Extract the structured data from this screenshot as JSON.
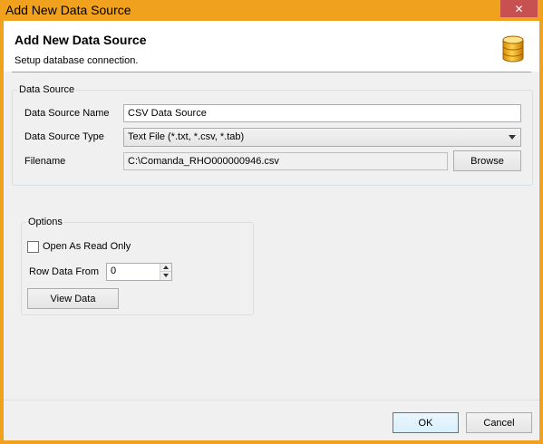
{
  "window": {
    "title": "Add New Data Source",
    "close_symbol": "✕"
  },
  "header": {
    "title": "Add New Data Source",
    "subtitle": "Setup database connection.",
    "icon": "database-icon"
  },
  "data_source": {
    "group_label": "Data Source",
    "name_label": "Data Source Name",
    "name_value": "CSV Data Source",
    "type_label": "Data Source Type",
    "type_value": "Text File (*.txt, *.csv, *.tab)",
    "filename_label": "Filename",
    "filename_value": "C:\\Comanda_RHO000000946.csv",
    "browse_label": "Browse"
  },
  "options": {
    "group_label": "Options",
    "read_only_label": "Open As Read Only",
    "read_only_checked": false,
    "row_data_label": "Row Data From",
    "row_data_value": "0",
    "view_data_label": "View Data"
  },
  "footer": {
    "ok_label": "OK",
    "cancel_label": "Cancel"
  },
  "colors": {
    "title_bar": "#f0a21e",
    "close_button": "#c75050",
    "dialog_bg": "#f0f0f0"
  }
}
